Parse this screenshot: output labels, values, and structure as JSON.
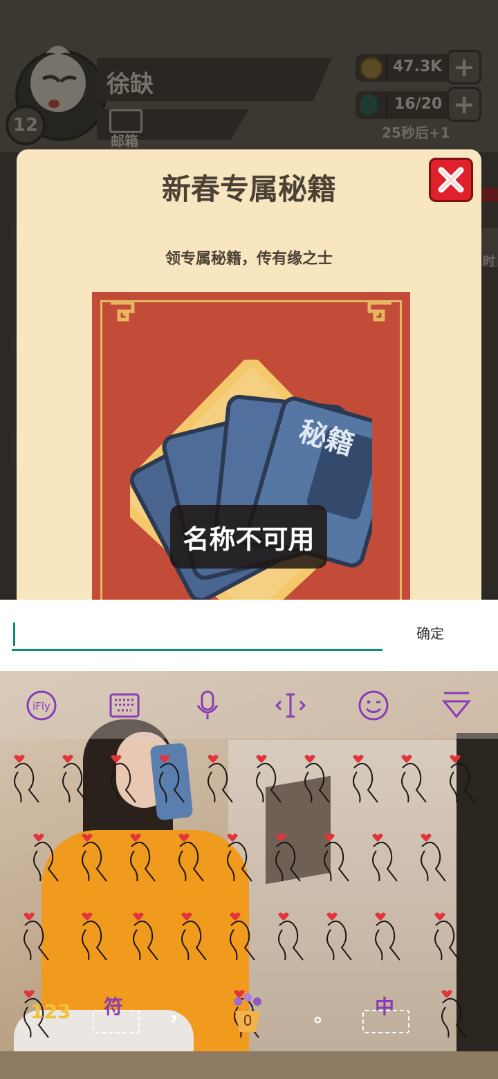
{
  "game": {
    "player_name": "徐缺",
    "level": "12",
    "mail_label": "邮箱",
    "coins": "47.3K",
    "energy": "16/20",
    "regen_timer": "25秒后+1",
    "side_fragment": "时"
  },
  "modal": {
    "title": "新春专属秘籍",
    "subtitle": "领专属秘籍，传有缘之士",
    "book_text": "秘籍",
    "close_icon": "close-x-icon"
  },
  "toast": {
    "message": "名称不可用"
  },
  "input_bar": {
    "value": "",
    "confirm_label": "确定"
  },
  "keyboard": {
    "toolbar_icons": [
      "ifly-logo-icon",
      "keyboard-icon",
      "microphone-icon",
      "cursor-move-icon",
      "emoji-icon",
      "collapse-icon"
    ],
    "keys": {
      "numbers": "123",
      "symbols": "符",
      "comma": "，",
      "period": "。",
      "lang": "中"
    },
    "accent_color": "#8a3bb5"
  }
}
